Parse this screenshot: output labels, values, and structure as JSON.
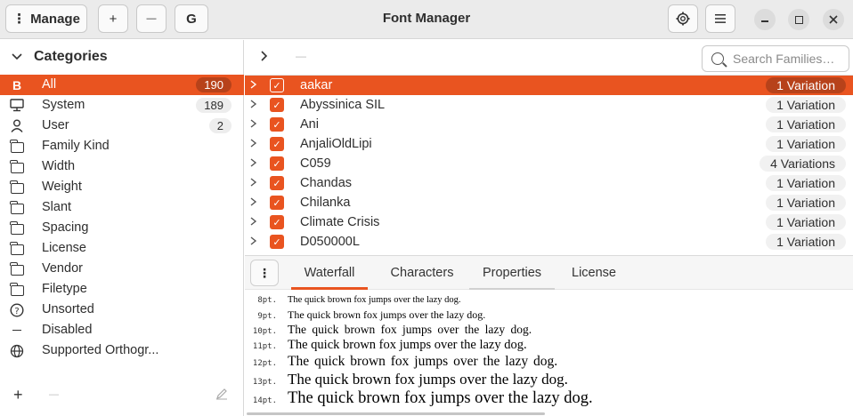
{
  "window": {
    "title": "Font Manager",
    "manage_label": "Manage",
    "manage_dots": "⋮",
    "add_label": "+",
    "remove_label": "—",
    "g_label": "G",
    "prefs_icon": "gear-icon",
    "menu_icon": "hamburger-icon"
  },
  "sidebar": {
    "header": "Categories",
    "items": [
      {
        "name": "All",
        "count": "190",
        "icon": "bold-b-icon",
        "selected": true
      },
      {
        "name": "System",
        "count": "189",
        "icon": "monitor-icon"
      },
      {
        "name": "User",
        "count": "2",
        "icon": "person-icon"
      },
      {
        "name": "Family Kind",
        "icon": "folder-icon"
      },
      {
        "name": "Width",
        "icon": "folder-icon"
      },
      {
        "name": "Weight",
        "icon": "folder-icon"
      },
      {
        "name": "Slant",
        "icon": "folder-icon"
      },
      {
        "name": "Spacing",
        "icon": "folder-icon"
      },
      {
        "name": "License",
        "icon": "folder-icon"
      },
      {
        "name": "Vendor",
        "icon": "folder-icon"
      },
      {
        "name": "Filetype",
        "icon": "folder-icon"
      },
      {
        "name": "Unsorted",
        "icon": "question-icon"
      },
      {
        "name": "Disabled",
        "icon": "dash-icon"
      },
      {
        "name": "Supported Orthogr...",
        "icon": "globe-icon"
      }
    ],
    "footer": {
      "add": "+",
      "remove": "—"
    }
  },
  "toolbar": {
    "search_placeholder": "Search Families…"
  },
  "fonts": [
    {
      "name": "aakar",
      "variations": "1 Variation",
      "selected": true
    },
    {
      "name": "Abyssinica SIL",
      "variations": "1 Variation"
    },
    {
      "name": "Ani",
      "variations": "1 Variation"
    },
    {
      "name": "AnjaliOldLipi",
      "variations": "1 Variation"
    },
    {
      "name": "C059",
      "variations": "4 Variations"
    },
    {
      "name": "Chandas",
      "variations": "1 Variation"
    },
    {
      "name": "Chilanka",
      "variations": "1 Variation"
    },
    {
      "name": "Climate Crisis",
      "variations": "1 Variation"
    },
    {
      "name": "D050000L",
      "variations": "1 Variation"
    }
  ],
  "preview": {
    "menu_label": "⋮",
    "tabs": [
      "Waterfall",
      "Characters",
      "Properties",
      "License"
    ],
    "active_tab": "Waterfall",
    "sample_text": "The quick brown fox jumps over the lazy dog.",
    "sizes": [
      "8pt.",
      "9pt.",
      "10pt.",
      "11pt.",
      "12pt.",
      "13pt.",
      "14pt."
    ]
  },
  "colors": {
    "accent": "#e95420",
    "accent_dark": "#b7421a"
  }
}
